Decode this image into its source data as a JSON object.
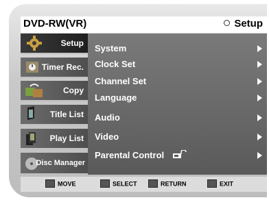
{
  "header": {
    "mode": "DVD-RW(VR)",
    "section": "Setup"
  },
  "sidebar": {
    "items": [
      {
        "label": "Setup",
        "icon": "gear-icon",
        "active": true
      },
      {
        "label": "Timer Rec.",
        "icon": "timer-icon",
        "active": false
      },
      {
        "label": "Copy",
        "icon": "copy-icon",
        "active": false
      },
      {
        "label": "Title List",
        "icon": "title-list-icon",
        "active": false
      },
      {
        "label": "Play List",
        "icon": "play-list-icon",
        "active": false
      },
      {
        "label": "Disc Manager",
        "icon": "disc-icon",
        "active": false
      }
    ]
  },
  "menu": {
    "items": [
      {
        "label": "System"
      },
      {
        "label": "Clock Set"
      },
      {
        "label": "Channel Set"
      },
      {
        "label": "Language"
      },
      {
        "label": "Audio"
      },
      {
        "label": "Video"
      },
      {
        "label": "Parental Control",
        "icon": "lock-icon"
      }
    ]
  },
  "footer": {
    "move": "MOVE",
    "select": "SELECT",
    "return": "RETURN",
    "exit": "EXIT"
  }
}
